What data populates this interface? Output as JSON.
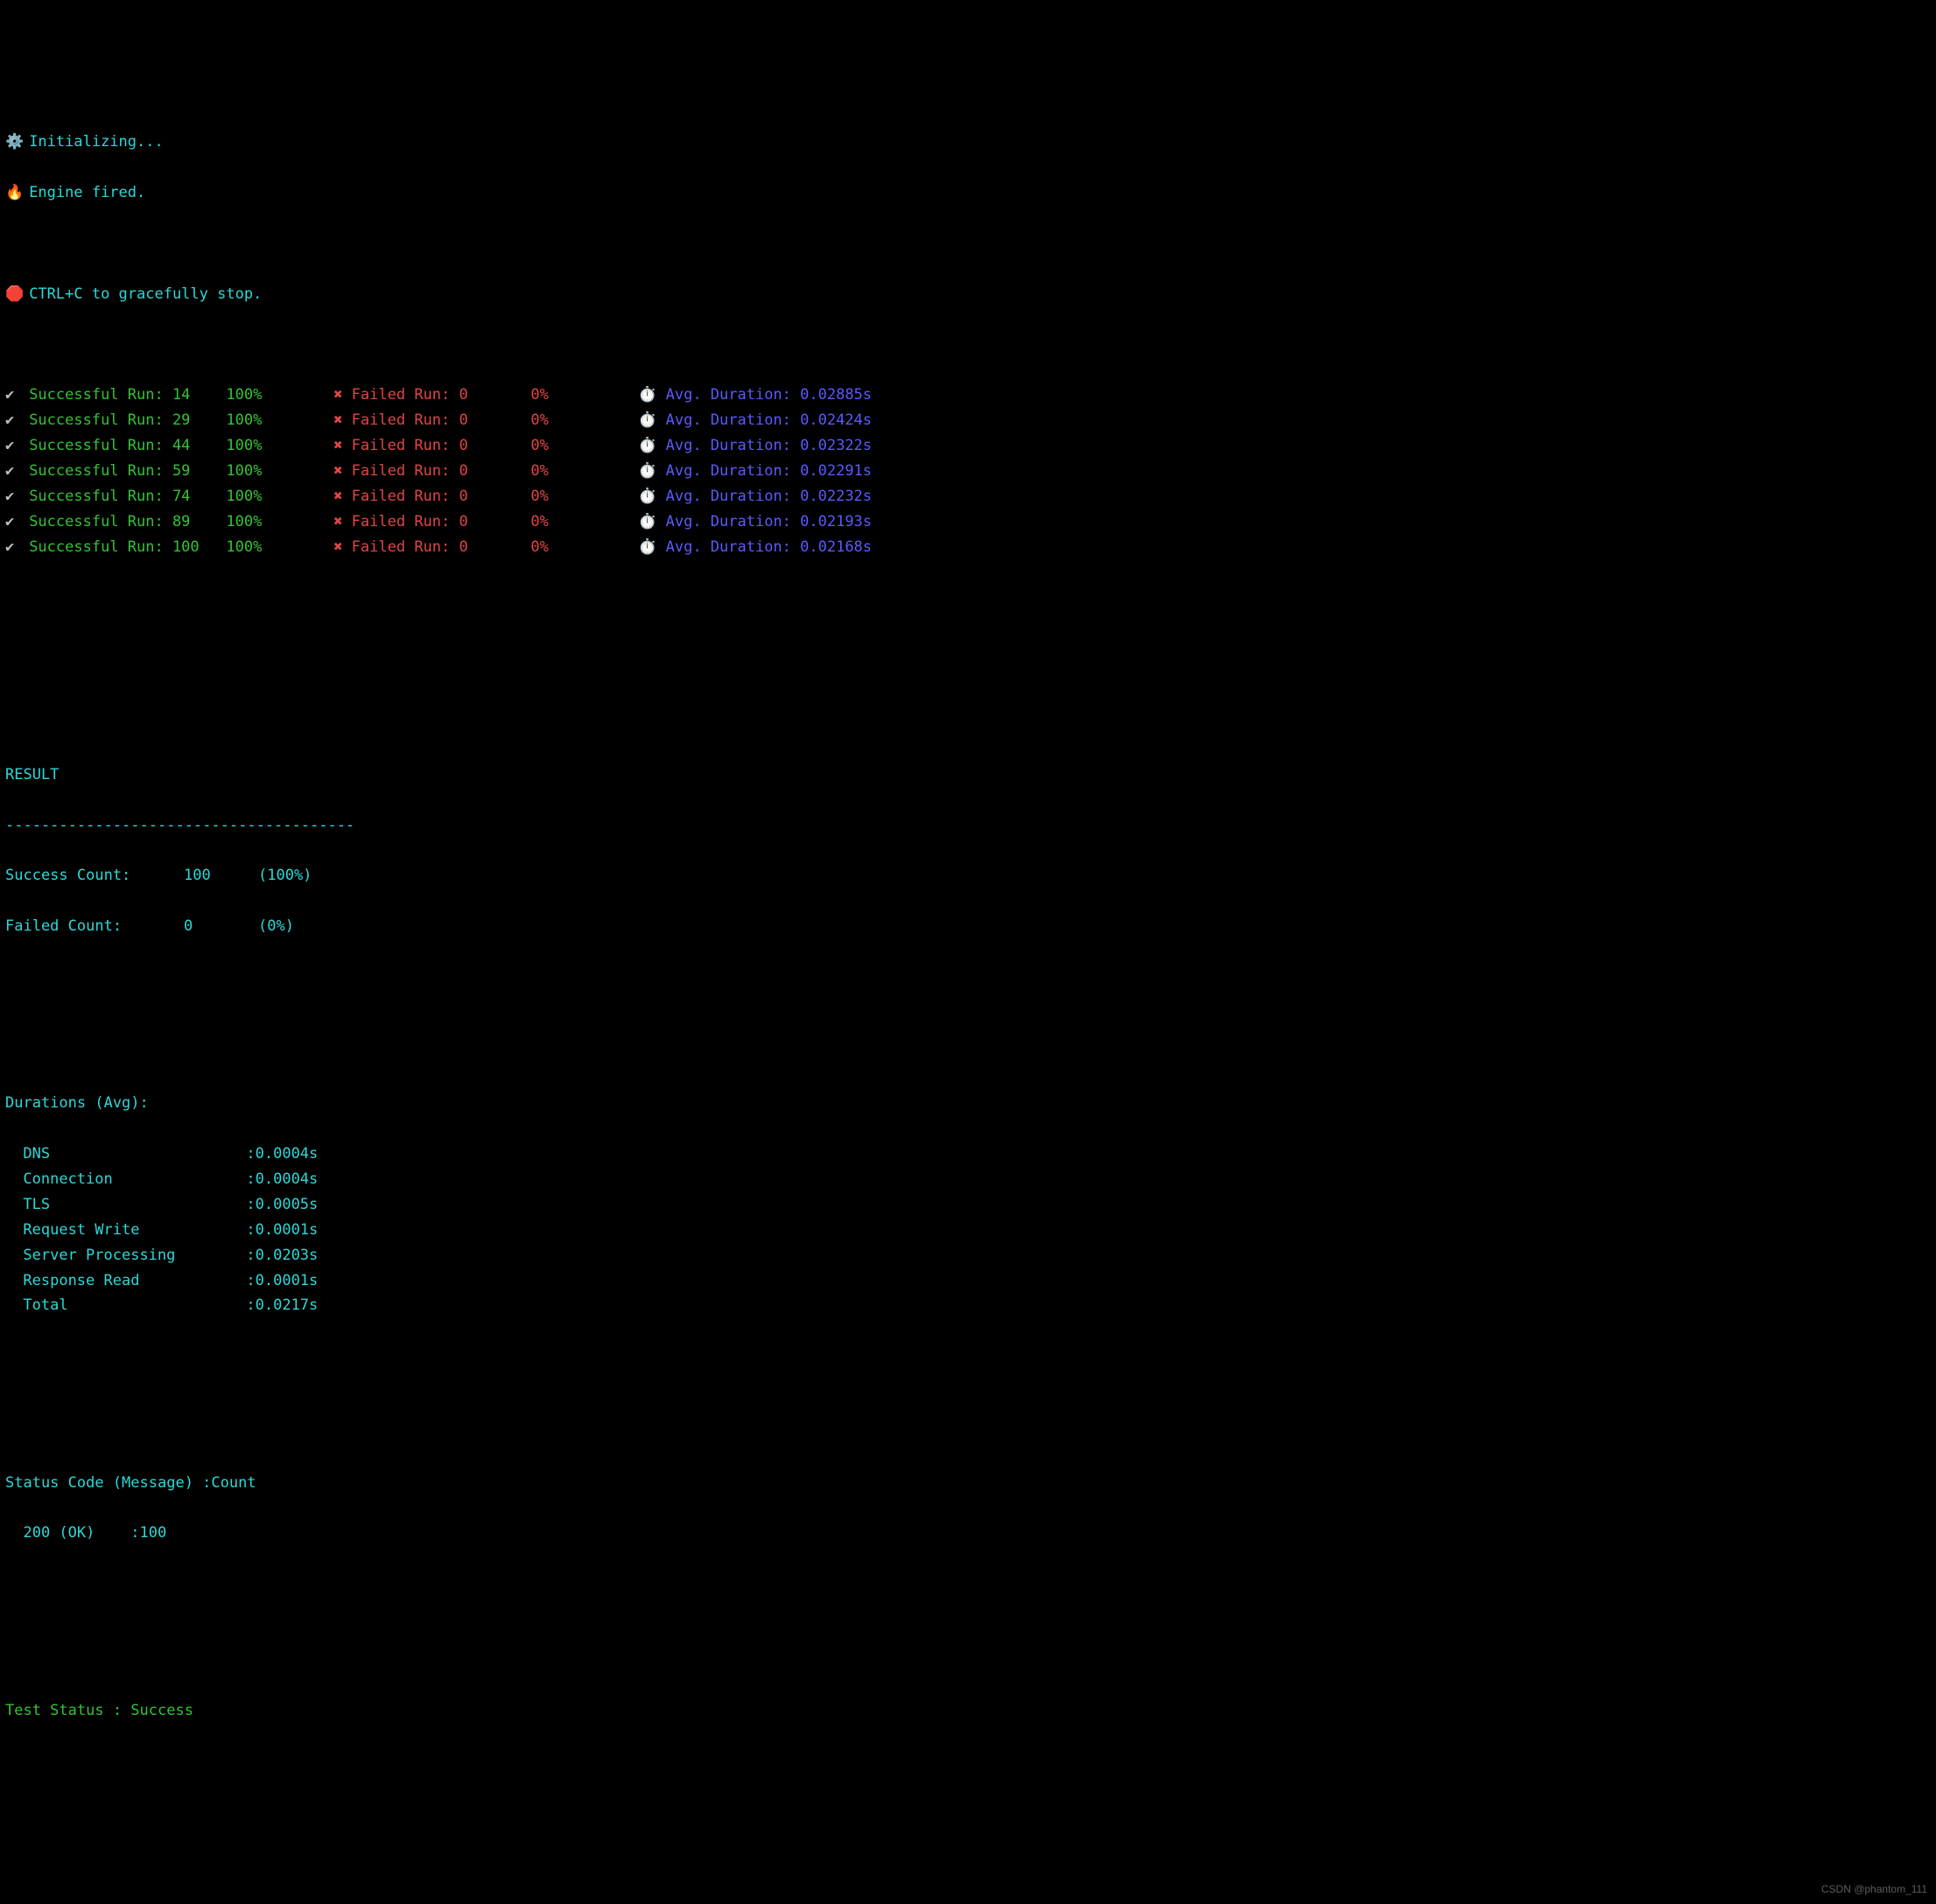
{
  "header": {
    "initializing_icon": "⚙️",
    "initializing_text": "Initializing...",
    "engine_icon": "🔥",
    "engine_text": "Engine fired.",
    "stop_icon": "🛑",
    "stop_text": "CTRL+C to gracefully stop."
  },
  "run_columns": {
    "success_icon": "✔",
    "success_label": "Successful Run:",
    "fail_icon": "✖",
    "fail_label": "Failed Run:",
    "avg_icon": "⏱️",
    "avg_label": "Avg. Duration:"
  },
  "runs": [
    {
      "success": "14",
      "success_pct": "100%",
      "failed": "0",
      "failed_pct": "0%",
      "avg": "0.02885s"
    },
    {
      "success": "29",
      "success_pct": "100%",
      "failed": "0",
      "failed_pct": "0%",
      "avg": "0.02424s"
    },
    {
      "success": "44",
      "success_pct": "100%",
      "failed": "0",
      "failed_pct": "0%",
      "avg": "0.02322s"
    },
    {
      "success": "59",
      "success_pct": "100%",
      "failed": "0",
      "failed_pct": "0%",
      "avg": "0.02291s"
    },
    {
      "success": "74",
      "success_pct": "100%",
      "failed": "0",
      "failed_pct": "0%",
      "avg": "0.02232s"
    },
    {
      "success": "89",
      "success_pct": "100%",
      "failed": "0",
      "failed_pct": "0%",
      "avg": "0.02193s"
    },
    {
      "success": "100",
      "success_pct": "100%",
      "failed": "0",
      "failed_pct": "0%",
      "avg": "0.02168s"
    }
  ],
  "result": {
    "heading": "RESULT",
    "divider": "---------------------------------------",
    "success_count_label": "Success Count:",
    "success_count_value": "100",
    "success_count_pct": "(100%)",
    "failed_count_label": "Failed Count:",
    "failed_count_value": "0",
    "failed_count_pct": "(0%)"
  },
  "durations": {
    "heading": "Durations (Avg):",
    "items": [
      {
        "label": "DNS",
        "value": ":0.0004s"
      },
      {
        "label": "Connection",
        "value": ":0.0004s"
      },
      {
        "label": "TLS",
        "value": ":0.0005s"
      },
      {
        "label": "Request Write",
        "value": ":0.0001s"
      },
      {
        "label": "Server Processing",
        "value": ":0.0203s"
      },
      {
        "label": "Response Read",
        "value": ":0.0001s"
      },
      {
        "label": "Total",
        "value": ":0.0217s"
      }
    ]
  },
  "status_code": {
    "heading": "Status Code (Message) :Count",
    "line": "200 (OK)    :100"
  },
  "test_status": {
    "label": "Test Status : ",
    "value": "Success"
  },
  "watermark": "CSDN @phantom_111"
}
